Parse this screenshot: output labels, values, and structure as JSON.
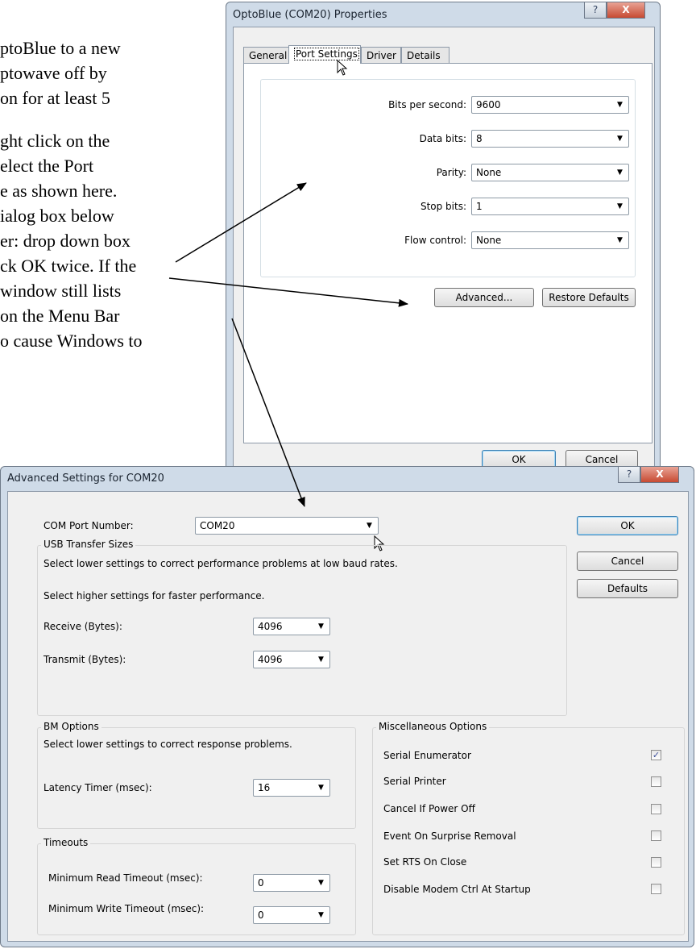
{
  "doc_text": {
    "lines": [
      "ptoBlue to a new",
      "ptowave off by",
      "on for at least 5",
      "",
      "ght click on the",
      "elect the Port",
      "e as shown here.",
      "ialog box below",
      "er: drop down box",
      "ck OK twice. If the",
      " window still lists",
      " on the Menu Bar",
      "o cause Windows to"
    ]
  },
  "props_window": {
    "title": "OptoBlue (COM20) Properties",
    "help_glyph": "?",
    "close_glyph": "X",
    "tabs": [
      "General",
      "Port Settings",
      "Driver",
      "Details"
    ],
    "fields": [
      {
        "label": "Bits per second:",
        "value": "9600"
      },
      {
        "label": "Data bits:",
        "value": "8"
      },
      {
        "label": "Parity:",
        "value": "None"
      },
      {
        "label": "Stop bits:",
        "value": "1"
      },
      {
        "label": "Flow control:",
        "value": "None"
      }
    ],
    "advanced_label": "Advanced...",
    "restore_label": "Restore Defaults",
    "ok_label": "OK",
    "cancel_label": "Cancel"
  },
  "adv_window": {
    "title": "Advanced Settings for COM20",
    "help_glyph": "?",
    "close_glyph": "X",
    "com_port_label": "COM Port Number:",
    "com_port_value": "COM20",
    "ok_label": "OK",
    "cancel_label": "Cancel",
    "defaults_label": "Defaults",
    "usb": {
      "title": "USB Transfer Sizes",
      "desc1": "Select lower settings to correct performance problems at low baud rates.",
      "desc2": "Select higher settings for faster performance.",
      "receive_label": "Receive (Bytes):",
      "receive_value": "4096",
      "transmit_label": "Transmit (Bytes):",
      "transmit_value": "4096"
    },
    "bm": {
      "title": "BM Options",
      "desc": "Select lower settings to correct response problems.",
      "latency_label": "Latency Timer (msec):",
      "latency_value": "16"
    },
    "timeouts": {
      "title": "Timeouts",
      "read_label": "Minimum Read Timeout (msec):",
      "read_value": "0",
      "write_label": "Minimum Write Timeout (msec):",
      "write_value": "0"
    },
    "misc": {
      "title": "Miscellaneous Options",
      "options": [
        {
          "label": "Serial Enumerator",
          "checked": true
        },
        {
          "label": "Serial Printer",
          "checked": false
        },
        {
          "label": "Cancel If Power Off",
          "checked": false
        },
        {
          "label": "Event On Surprise Removal",
          "checked": false
        },
        {
          "label": "Set RTS On Close",
          "checked": false
        },
        {
          "label": "Disable Modem Ctrl At Startup",
          "checked": false
        }
      ]
    }
  },
  "colors": {
    "window_frame": "#cfdbe8",
    "dialog_bg": "#f0f0f0",
    "close_button": "#c74a32"
  },
  "icons": {
    "dropdown": "chevron-down-icon",
    "checkmark": "check-icon",
    "cursor": "mouse-pointer-icon"
  }
}
